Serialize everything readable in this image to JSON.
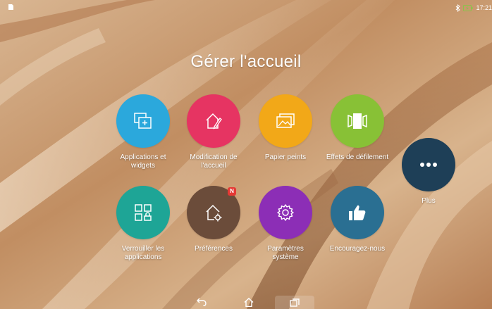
{
  "status_bar": {
    "time": "17:21",
    "icons": [
      "sim-icon",
      "bluetooth-icon",
      "battery-charging-icon"
    ],
    "battery_color": "#8bc34a"
  },
  "title": "Gérer l'accueil",
  "tiles": [
    {
      "label": "Applications et widgets",
      "icon": "add-widget-icon",
      "color": "#2ba8dc"
    },
    {
      "label": "Modification de l'accueil",
      "icon": "edit-home-icon",
      "color": "#e63462"
    },
    {
      "label": "Papier peints",
      "icon": "wallpaper-icon",
      "color": "#f2a818"
    },
    {
      "label": "Effets de défilement",
      "icon": "scroll-effects-icon",
      "color": "#88c136"
    },
    {
      "label": "Plus",
      "icon": "more-icon",
      "color": "#1e3f57"
    },
    {
      "label": "Verrouiller les applications",
      "icon": "lock-apps-icon",
      "color": "#1ea596"
    },
    {
      "label": "Préférences",
      "icon": "home-settings-icon",
      "color": "#6b4c3a",
      "badge": "N"
    },
    {
      "label": "Paramètres système",
      "icon": "gear-icon",
      "color": "#8c2eb6"
    },
    {
      "label": "Encouragez-nous",
      "icon": "thumbs-up-icon",
      "color": "#2a6f92"
    }
  ],
  "nav": [
    "back-icon",
    "home-icon",
    "recent-apps-icon"
  ]
}
